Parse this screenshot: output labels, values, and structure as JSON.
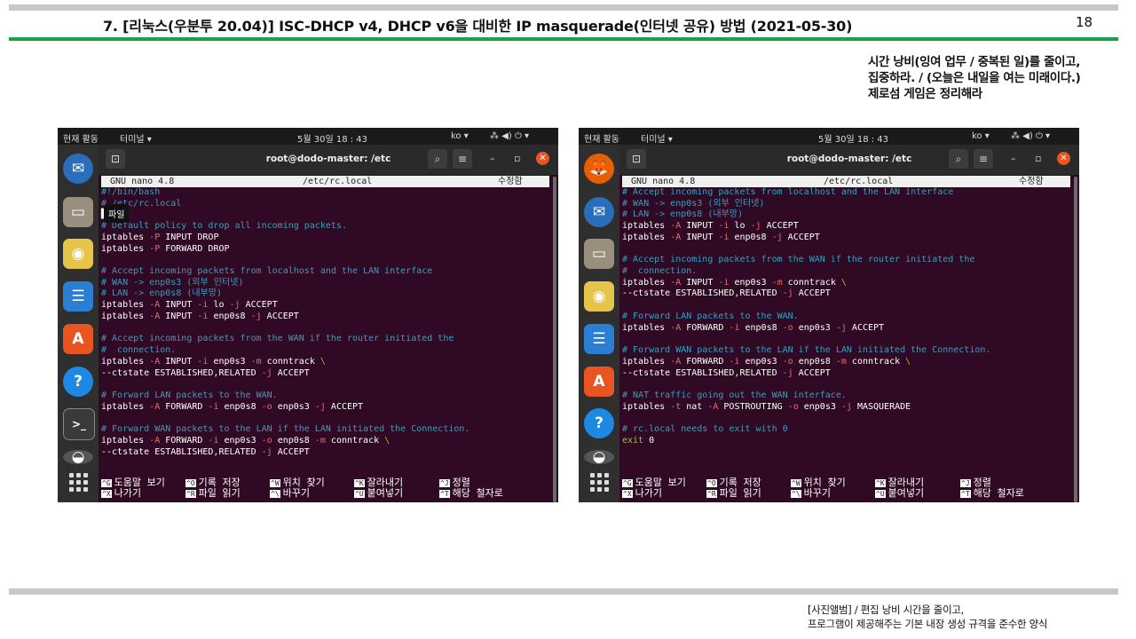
{
  "header": {
    "title": "7. [리눅스(우분투 20.04)] ISC-DHCP v4, DHCP v6을 대비한 IP masquerade(인터넷 공유) 방법 (2021-05-30)",
    "page_number": "18"
  },
  "motto": [
    "시간 낭비(잉여 업무 / 중복된 일)를 줄이고,",
    "집중하라. / (오늘은 내일을 여는 미래이다.)",
    "제로섬 게임은 정리해라"
  ],
  "footer": [
    "[사진앨범] / 편집 낭비 시간을 줄이고,",
    "프로그램이 제공해주는 기본 내장 생성 규격을 준수한 양식"
  ],
  "screens": [
    {
      "activities": "현재 활동",
      "app_menu": "터미널 ▾",
      "clock": "5월 30일  18 : 43",
      "lang": "ko ▾",
      "status_icons": "⁂ ◀) ⏻ ▾",
      "window_title": "root@dodo-master: /etc",
      "tooltip": "파일",
      "nano": {
        "version": "GNU nano 4.8",
        "file": "/etc/rc.local",
        "state": "수정함"
      },
      "dock": [
        "thunderbird-icon",
        "files-icon",
        "rhythmbox-icon",
        "writer-icon",
        "software-center-icon",
        "help-icon",
        "terminal-icon",
        "disk-icon",
        "app-grid-icon"
      ],
      "lines": [
        [
          [
            "c",
            "#!/bin/bash"
          ]
        ],
        [
          [
            "c",
            "# /etc/rc.local"
          ]
        ],
        [
          [
            "w",
            "▌"
          ]
        ],
        [
          [
            "c",
            "# Default policy to drop all incoming packets."
          ]
        ],
        [
          [
            "w",
            "iptables "
          ],
          [
            "f",
            "-P"
          ],
          [
            "w",
            " INPUT DROP"
          ]
        ],
        [
          [
            "w",
            "iptables "
          ],
          [
            "f",
            "-P"
          ],
          [
            "w",
            " FORWARD DROP"
          ]
        ],
        [
          [
            "w",
            ""
          ]
        ],
        [
          [
            "c",
            "# Accept incoming packets from localhost and the LAN interface"
          ]
        ],
        [
          [
            "c",
            "# WAN -> enp0s3 (외부 인터넷)"
          ]
        ],
        [
          [
            "c",
            "# LAN -> enp0s8 (내부망)"
          ]
        ],
        [
          [
            "w",
            "iptables "
          ],
          [
            "f",
            "-A"
          ],
          [
            "w",
            " INPUT "
          ],
          [
            "f",
            "-i"
          ],
          [
            "w",
            " lo "
          ],
          [
            "f",
            "-j"
          ],
          [
            "w",
            " ACCEPT"
          ]
        ],
        [
          [
            "w",
            "iptables "
          ],
          [
            "f",
            "-A"
          ],
          [
            "w",
            " INPUT "
          ],
          [
            "f",
            "-i"
          ],
          [
            "w",
            " enp0s8 "
          ],
          [
            "f",
            "-j"
          ],
          [
            "w",
            " ACCEPT"
          ]
        ],
        [
          [
            "w",
            ""
          ]
        ],
        [
          [
            "c",
            "# Accept incoming packets from the WAN if the router initiated the"
          ]
        ],
        [
          [
            "c",
            "#  connection."
          ]
        ],
        [
          [
            "w",
            "iptables "
          ],
          [
            "f",
            "-A"
          ],
          [
            "w",
            " INPUT "
          ],
          [
            "f",
            "-i"
          ],
          [
            "w",
            " enp0s3 "
          ],
          [
            "f",
            "-m"
          ],
          [
            "w",
            " conntrack "
          ],
          [
            "g",
            "\\"
          ]
        ],
        [
          [
            "w",
            "--ctstate ESTABLISHED,RELATED "
          ],
          [
            "f",
            "-j"
          ],
          [
            "w",
            " ACCEPT"
          ]
        ],
        [
          [
            "w",
            ""
          ]
        ],
        [
          [
            "c",
            "# Forward LAN packets to the WAN."
          ]
        ],
        [
          [
            "w",
            "iptables "
          ],
          [
            "f",
            "-A"
          ],
          [
            "w",
            " FORWARD "
          ],
          [
            "f",
            "-i"
          ],
          [
            "w",
            " enp0s8 "
          ],
          [
            "f",
            "-o"
          ],
          [
            "w",
            " enp0s3 "
          ],
          [
            "f",
            "-j"
          ],
          [
            "w",
            " ACCEPT"
          ]
        ],
        [
          [
            "w",
            ""
          ]
        ],
        [
          [
            "c",
            "# Forward WAN packets to the LAN if the LAN initiated the Connection."
          ]
        ],
        [
          [
            "w",
            "iptables "
          ],
          [
            "f",
            "-A"
          ],
          [
            "w",
            " FORWARD "
          ],
          [
            "f",
            "-i"
          ],
          [
            "w",
            " enp0s3 "
          ],
          [
            "f",
            "-o"
          ],
          [
            "w",
            " enp0s8 "
          ],
          [
            "f",
            "-m"
          ],
          [
            "w",
            " conntrack "
          ],
          [
            "g",
            "\\"
          ]
        ],
        [
          [
            "w",
            "--ctstate ESTABLISHED,RELATED "
          ],
          [
            "f",
            "-j"
          ],
          [
            "w",
            " ACCEPT"
          ]
        ]
      ],
      "shortcuts": [
        [
          "^G",
          "도움말 보기"
        ],
        [
          "^O",
          "기록 저장"
        ],
        [
          "^W",
          "위치 찾기"
        ],
        [
          "^K",
          "잘라내기"
        ],
        [
          "^J",
          "정렬"
        ],
        [
          "^X",
          "나가기"
        ],
        [
          "^R",
          "파일 읽기"
        ],
        [
          "^\\",
          "바꾸기"
        ],
        [
          "^U",
          "붙여넣기"
        ],
        [
          "^T",
          "해당 철자로"
        ]
      ]
    },
    {
      "activities": "현재 활동",
      "app_menu": "터미널 ▾",
      "clock": "5월 30일  18 : 43",
      "lang": "ko ▾",
      "status_icons": "⁂ ◀) ⏻ ▾",
      "window_title": "root@dodo-master: /etc",
      "tooltip": "",
      "nano": {
        "version": "GNU nano 4.8",
        "file": "/etc/rc.local",
        "state": "수정함"
      },
      "dock": [
        "firefox-icon",
        "thunderbird-icon",
        "files-icon",
        "rhythmbox-icon",
        "writer-icon",
        "software-center-icon",
        "help-icon",
        "disk-icon",
        "app-grid-icon"
      ],
      "lines": [
        [
          [
            "c",
            "# Accept incoming packets from localhost and the LAN interface"
          ]
        ],
        [
          [
            "c",
            "# WAN -> enp0s3 (외부 인터넷)"
          ]
        ],
        [
          [
            "c",
            "# LAN -> enp0s8 (내부망)"
          ]
        ],
        [
          [
            "w",
            "iptables "
          ],
          [
            "f",
            "-A"
          ],
          [
            "w",
            " INPUT "
          ],
          [
            "f",
            "-i"
          ],
          [
            "w",
            " lo "
          ],
          [
            "f",
            "-j"
          ],
          [
            "w",
            " ACCEPT"
          ]
        ],
        [
          [
            "w",
            "iptables "
          ],
          [
            "f",
            "-A"
          ],
          [
            "w",
            " INPUT "
          ],
          [
            "f",
            "-i"
          ],
          [
            "w",
            " enp0s8 "
          ],
          [
            "f",
            "-j"
          ],
          [
            "w",
            " ACCEPT"
          ]
        ],
        [
          [
            "w",
            ""
          ]
        ],
        [
          [
            "c",
            "# Accept incoming packets from the WAN if the router initiated the"
          ]
        ],
        [
          [
            "c",
            "#  connection."
          ]
        ],
        [
          [
            "w",
            "iptables "
          ],
          [
            "f",
            "-A"
          ],
          [
            "w",
            " INPUT "
          ],
          [
            "f",
            "-i"
          ],
          [
            "w",
            " enp0s3 "
          ],
          [
            "f",
            "-m"
          ],
          [
            "w",
            " conntrack "
          ],
          [
            "g",
            "\\"
          ]
        ],
        [
          [
            "w",
            "--ctstate ESTABLISHED,RELATED "
          ],
          [
            "f",
            "-j"
          ],
          [
            "w",
            " ACCEPT"
          ]
        ],
        [
          [
            "w",
            ""
          ]
        ],
        [
          [
            "c",
            "# Forward LAN packets to the WAN."
          ]
        ],
        [
          [
            "w",
            "iptables "
          ],
          [
            "f",
            "-A"
          ],
          [
            "w",
            " FORWARD "
          ],
          [
            "f",
            "-i"
          ],
          [
            "w",
            " enp0s8 "
          ],
          [
            "f",
            "-o"
          ],
          [
            "w",
            " enp0s3 "
          ],
          [
            "f",
            "-j"
          ],
          [
            "w",
            " ACCEPT"
          ]
        ],
        [
          [
            "w",
            ""
          ]
        ],
        [
          [
            "c",
            "# Forward WAN packets to the LAN if the LAN initiated the Connection."
          ]
        ],
        [
          [
            "w",
            "iptables "
          ],
          [
            "f",
            "-A"
          ],
          [
            "w",
            " FORWARD "
          ],
          [
            "f",
            "-i"
          ],
          [
            "w",
            " enp0s3 "
          ],
          [
            "f",
            "-o"
          ],
          [
            "w",
            " enp0s8 "
          ],
          [
            "f",
            "-m"
          ],
          [
            "w",
            " conntrack "
          ],
          [
            "g",
            "\\"
          ]
        ],
        [
          [
            "w",
            "--ctstate ESTABLISHED,RELATED "
          ],
          [
            "f",
            "-j"
          ],
          [
            "w",
            " ACCEPT"
          ]
        ],
        [
          [
            "w",
            ""
          ]
        ],
        [
          [
            "c",
            "# NAT traffic going out the WAN interface."
          ]
        ],
        [
          [
            "w",
            "iptables "
          ],
          [
            "f",
            "-t"
          ],
          [
            "w",
            " nat "
          ],
          [
            "f",
            "-A"
          ],
          [
            "w",
            " POSTROUTING "
          ],
          [
            "f",
            "-o"
          ],
          [
            "w",
            " enp0s3 "
          ],
          [
            "f",
            "-j"
          ],
          [
            "w",
            " MASQUERADE"
          ]
        ],
        [
          [
            "w",
            ""
          ]
        ],
        [
          [
            "c",
            "# rc.local needs to exit with 0"
          ]
        ],
        [
          [
            "g",
            "exit "
          ],
          [
            "w",
            "0"
          ]
        ]
      ],
      "shortcuts": [
        [
          "^G",
          "도움말 보기"
        ],
        [
          "^O",
          "기록 저장"
        ],
        [
          "^W",
          "위치 찾기"
        ],
        [
          "^K",
          "잘라내기"
        ],
        [
          "^J",
          "정렬"
        ],
        [
          "^X",
          "나가기"
        ],
        [
          "^R",
          "파일 읽기"
        ],
        [
          "^\\",
          "바꾸기"
        ],
        [
          "^U",
          "붙여넣기"
        ],
        [
          "^T",
          "해당 철자로"
        ]
      ]
    }
  ]
}
